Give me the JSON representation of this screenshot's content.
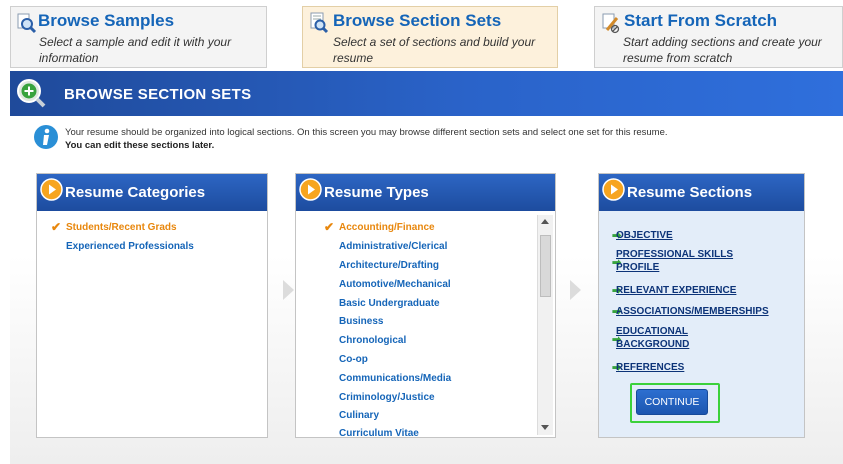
{
  "options": [
    {
      "title": "Browse Samples",
      "desc": "Select a sample and edit it with your information",
      "icon": "magnifier-icon"
    },
    {
      "title": "Browse Section Sets",
      "desc": "Select a set of sections and build your resume",
      "icon": "magnifier-document-icon"
    },
    {
      "title": "Start From Scratch",
      "desc": "Start adding sections and create your resume from scratch",
      "icon": "pencil-icon"
    }
  ],
  "banner": {
    "title": "BROWSE SECTION SETS"
  },
  "info": {
    "line1": "Your resume should be organized into logical sections. On this screen you may browse different section sets and select one set for this resume.",
    "line2": "You can edit these sections later."
  },
  "categories": {
    "title": "Resume Categories",
    "items": [
      "Students/Recent Grads",
      "Experienced Professionals"
    ]
  },
  "types": {
    "title": "Resume Types",
    "items": [
      "Accounting/Finance",
      "Administrative/Clerical",
      "Architecture/Drafting",
      "Automotive/Mechanical",
      "Basic Undergraduate",
      "Business",
      "Chronological",
      "Co-op",
      "Communications/Media",
      "Criminology/Justice",
      "Culinary",
      "Curriculum Vitae"
    ]
  },
  "sections": {
    "title": "Resume Sections",
    "items": [
      [
        "OBJECTIVE"
      ],
      [
        "PROFESSIONAL SKILLS",
        "PROFILE"
      ],
      [
        "RELEVANT EXPERIENCE"
      ],
      [
        "ASSOCIATIONS/MEMBERSHIPS"
      ],
      [
        "EDUCATIONAL",
        "BACKGROUND"
      ],
      [
        "REFERENCES"
      ]
    ],
    "continue_label": "CONTINUE"
  },
  "colors": {
    "accent": "#1565b8",
    "selected": "#e8870d",
    "banner": "#2a63c9",
    "highlight": "#3bd13b"
  }
}
